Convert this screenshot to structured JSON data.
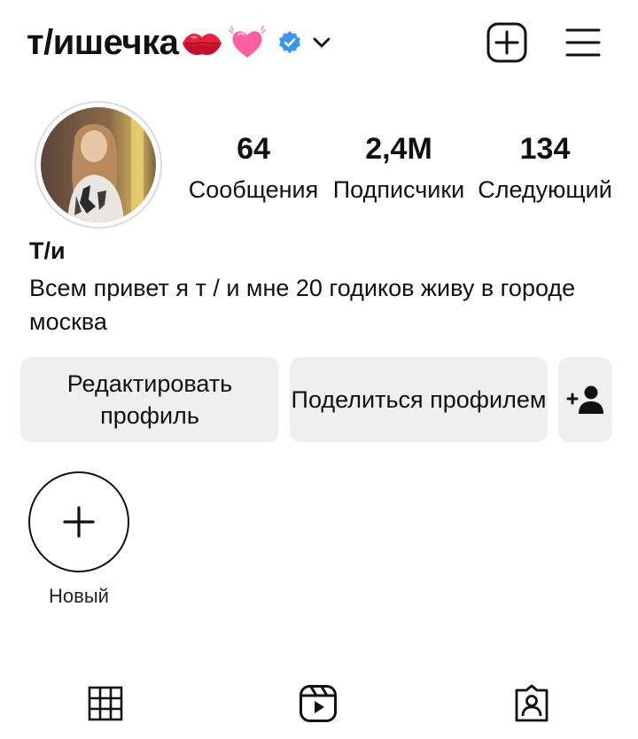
{
  "header": {
    "username": "т/ишечка",
    "icons": {
      "lips": "kiss-lips-emoji",
      "heart": "pink-heart-emoji",
      "verified": "verified-badge-icon",
      "dropdown": "chevron-down-icon",
      "add": "plus-square-icon",
      "menu": "hamburger-menu-icon"
    },
    "colors": {
      "verified": "#3897f0",
      "heart": "#ff5fa2",
      "lips": "#e5213b"
    }
  },
  "profile": {
    "stats": {
      "posts": {
        "value": "64",
        "label": "Сообщения"
      },
      "followers": {
        "value": "2,4M",
        "label": "Подписчики"
      },
      "following": {
        "value": "134",
        "label": "Следующий"
      }
    },
    "display_name": "Т/и",
    "bio": "Всем привет я т / и  мне 20 годиков живу в городе  москва"
  },
  "actions": {
    "edit_profile": "Редактировать профиль",
    "share_profile": "Поделиться профилем",
    "add_user_icon": "add-person-icon"
  },
  "highlights": {
    "new_label": "Новый"
  },
  "tabs": {
    "icons": [
      "grid-icon",
      "reels-icon",
      "tagged-person-icon"
    ]
  }
}
